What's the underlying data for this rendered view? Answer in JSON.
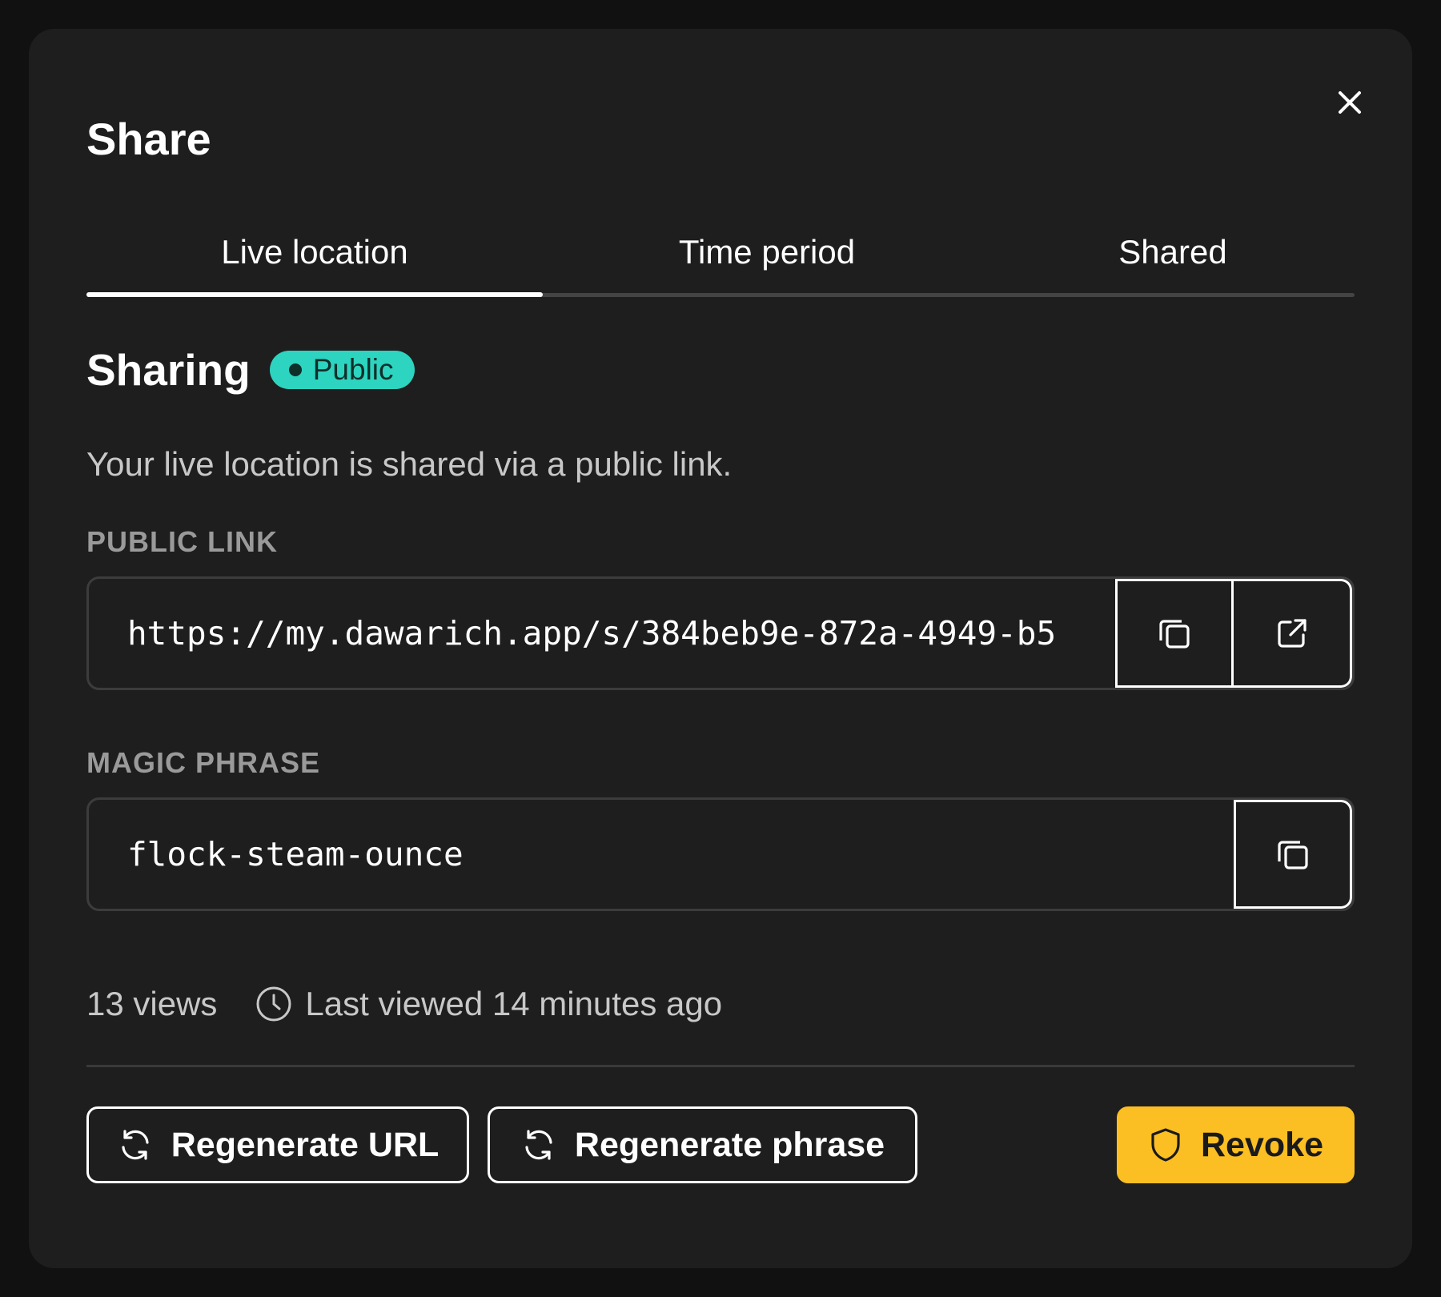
{
  "dialog": {
    "title": "Share",
    "close_icon": "close-icon"
  },
  "tabs": [
    {
      "label": "Live location",
      "active": true
    },
    {
      "label": "Time period",
      "active": false
    },
    {
      "label": "Shared",
      "active": false
    }
  ],
  "sharing": {
    "heading": "Sharing",
    "badge": "Public",
    "badge_color": "#2dd4bf",
    "description": "Your live location is shared via a public link."
  },
  "public_link": {
    "label": "PUBLIC LINK",
    "value": "https://my.dawarich.app/s/384beb9e-872a-4949-b5",
    "copy_icon": "copy-icon",
    "open_icon": "external-link-icon"
  },
  "magic_phrase": {
    "label": "MAGIC PHRASE",
    "value": "flock-steam-ounce",
    "copy_icon": "copy-icon"
  },
  "stats": {
    "views": "13 views",
    "last_viewed": "Last viewed 14 minutes ago",
    "clock_icon": "clock-icon"
  },
  "actions": {
    "regenerate_url": "Regenerate URL",
    "regenerate_phrase": "Regenerate phrase",
    "revoke": "Revoke",
    "revoke_color": "#fbbf24",
    "refresh_icon": "refresh-icon",
    "shield_icon": "shield-icon"
  }
}
